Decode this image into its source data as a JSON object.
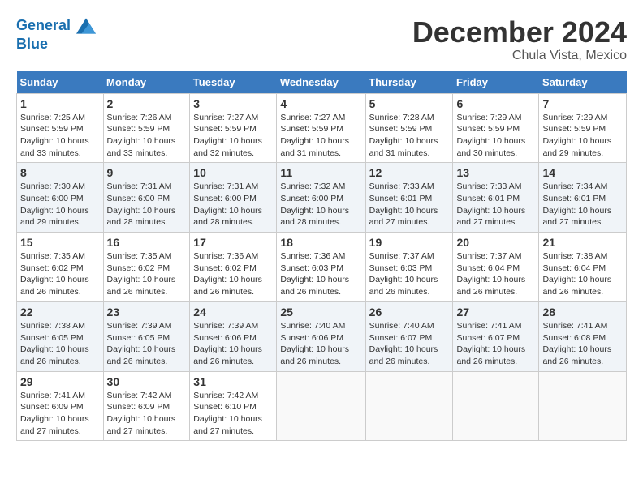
{
  "header": {
    "logo_line1": "General",
    "logo_line2": "Blue",
    "month_title": "December 2024",
    "location": "Chula Vista, Mexico"
  },
  "weekdays": [
    "Sunday",
    "Monday",
    "Tuesday",
    "Wednesday",
    "Thursday",
    "Friday",
    "Saturday"
  ],
  "weeks": [
    [
      {
        "day": "1",
        "sunrise": "7:25 AM",
        "sunset": "5:59 PM",
        "daylight": "10 hours and 33 minutes."
      },
      {
        "day": "2",
        "sunrise": "7:26 AM",
        "sunset": "5:59 PM",
        "daylight": "10 hours and 33 minutes."
      },
      {
        "day": "3",
        "sunrise": "7:27 AM",
        "sunset": "5:59 PM",
        "daylight": "10 hours and 32 minutes."
      },
      {
        "day": "4",
        "sunrise": "7:27 AM",
        "sunset": "5:59 PM",
        "daylight": "10 hours and 31 minutes."
      },
      {
        "day": "5",
        "sunrise": "7:28 AM",
        "sunset": "5:59 PM",
        "daylight": "10 hours and 31 minutes."
      },
      {
        "day": "6",
        "sunrise": "7:29 AM",
        "sunset": "5:59 PM",
        "daylight": "10 hours and 30 minutes."
      },
      {
        "day": "7",
        "sunrise": "7:29 AM",
        "sunset": "5:59 PM",
        "daylight": "10 hours and 29 minutes."
      }
    ],
    [
      {
        "day": "8",
        "sunrise": "7:30 AM",
        "sunset": "6:00 PM",
        "daylight": "10 hours and 29 minutes."
      },
      {
        "day": "9",
        "sunrise": "7:31 AM",
        "sunset": "6:00 PM",
        "daylight": "10 hours and 28 minutes."
      },
      {
        "day": "10",
        "sunrise": "7:31 AM",
        "sunset": "6:00 PM",
        "daylight": "10 hours and 28 minutes."
      },
      {
        "day": "11",
        "sunrise": "7:32 AM",
        "sunset": "6:00 PM",
        "daylight": "10 hours and 28 minutes."
      },
      {
        "day": "12",
        "sunrise": "7:33 AM",
        "sunset": "6:01 PM",
        "daylight": "10 hours and 27 minutes."
      },
      {
        "day": "13",
        "sunrise": "7:33 AM",
        "sunset": "6:01 PM",
        "daylight": "10 hours and 27 minutes."
      },
      {
        "day": "14",
        "sunrise": "7:34 AM",
        "sunset": "6:01 PM",
        "daylight": "10 hours and 27 minutes."
      }
    ],
    [
      {
        "day": "15",
        "sunrise": "7:35 AM",
        "sunset": "6:02 PM",
        "daylight": "10 hours and 26 minutes."
      },
      {
        "day": "16",
        "sunrise": "7:35 AM",
        "sunset": "6:02 PM",
        "daylight": "10 hours and 26 minutes."
      },
      {
        "day": "17",
        "sunrise": "7:36 AM",
        "sunset": "6:02 PM",
        "daylight": "10 hours and 26 minutes."
      },
      {
        "day": "18",
        "sunrise": "7:36 AM",
        "sunset": "6:03 PM",
        "daylight": "10 hours and 26 minutes."
      },
      {
        "day": "19",
        "sunrise": "7:37 AM",
        "sunset": "6:03 PM",
        "daylight": "10 hours and 26 minutes."
      },
      {
        "day": "20",
        "sunrise": "7:37 AM",
        "sunset": "6:04 PM",
        "daylight": "10 hours and 26 minutes."
      },
      {
        "day": "21",
        "sunrise": "7:38 AM",
        "sunset": "6:04 PM",
        "daylight": "10 hours and 26 minutes."
      }
    ],
    [
      {
        "day": "22",
        "sunrise": "7:38 AM",
        "sunset": "6:05 PM",
        "daylight": "10 hours and 26 minutes."
      },
      {
        "day": "23",
        "sunrise": "7:39 AM",
        "sunset": "6:05 PM",
        "daylight": "10 hours and 26 minutes."
      },
      {
        "day": "24",
        "sunrise": "7:39 AM",
        "sunset": "6:06 PM",
        "daylight": "10 hours and 26 minutes."
      },
      {
        "day": "25",
        "sunrise": "7:40 AM",
        "sunset": "6:06 PM",
        "daylight": "10 hours and 26 minutes."
      },
      {
        "day": "26",
        "sunrise": "7:40 AM",
        "sunset": "6:07 PM",
        "daylight": "10 hours and 26 minutes."
      },
      {
        "day": "27",
        "sunrise": "7:41 AM",
        "sunset": "6:07 PM",
        "daylight": "10 hours and 26 minutes."
      },
      {
        "day": "28",
        "sunrise": "7:41 AM",
        "sunset": "6:08 PM",
        "daylight": "10 hours and 26 minutes."
      }
    ],
    [
      {
        "day": "29",
        "sunrise": "7:41 AM",
        "sunset": "6:09 PM",
        "daylight": "10 hours and 27 minutes."
      },
      {
        "day": "30",
        "sunrise": "7:42 AM",
        "sunset": "6:09 PM",
        "daylight": "10 hours and 27 minutes."
      },
      {
        "day": "31",
        "sunrise": "7:42 AM",
        "sunset": "6:10 PM",
        "daylight": "10 hours and 27 minutes."
      },
      null,
      null,
      null,
      null
    ]
  ]
}
